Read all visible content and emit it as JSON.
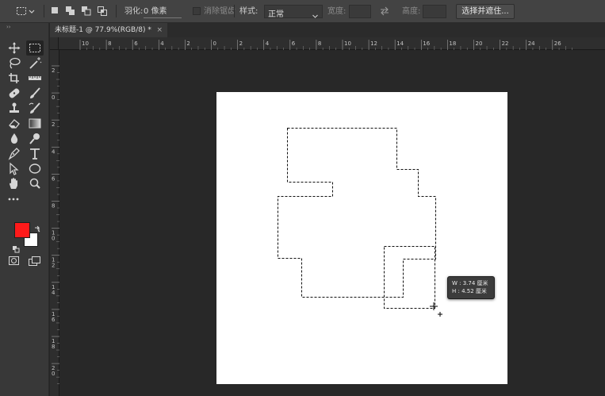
{
  "options_bar": {
    "feather_label": "羽化:",
    "feather_value": "0 像素",
    "antialias_label": "消除锯齿",
    "style_label": "样式:",
    "style_value": "正常",
    "width_label": "宽度:",
    "height_label": "高度:",
    "select_mask_button": "选择并遮住..."
  },
  "document": {
    "tab_title": "未标题-1 @ 77.9%(RGB/8) *",
    "tab_close": "×"
  },
  "rulers": {
    "horizontal": [
      "10",
      "8",
      "6",
      "4",
      "2",
      "0",
      "2",
      "4",
      "6",
      "8",
      "10",
      "12",
      "14",
      "16",
      "18",
      "20",
      "22",
      "24",
      "26"
    ],
    "vertical": [
      "2",
      "0",
      "2",
      "4",
      "6",
      "8",
      "10",
      "12",
      "14",
      "16",
      "18",
      "20"
    ]
  },
  "size_tooltip": {
    "width_text": "W : 3.74 厘米",
    "height_text": "H : 4.52 厘米"
  },
  "colors": {
    "foreground": "#ff1a1a",
    "background": "#ffffff",
    "ui_panel": "#383838",
    "pasteboard": "#282828"
  },
  "tools": [
    "move-icon",
    "marquee-icon",
    "lasso-icon",
    "magic-wand-icon",
    "crop-icon",
    "ruler-icon",
    "healing-brush-icon",
    "brush-icon",
    "clone-stamp-icon",
    "history-brush-icon",
    "eraser-icon",
    "gradient-icon",
    "blur-icon",
    "dodge-icon",
    "pen-icon",
    "type-icon",
    "path-select-icon",
    "ellipse-icon",
    "hand-icon",
    "zoom-icon",
    "more-tools-icon"
  ]
}
